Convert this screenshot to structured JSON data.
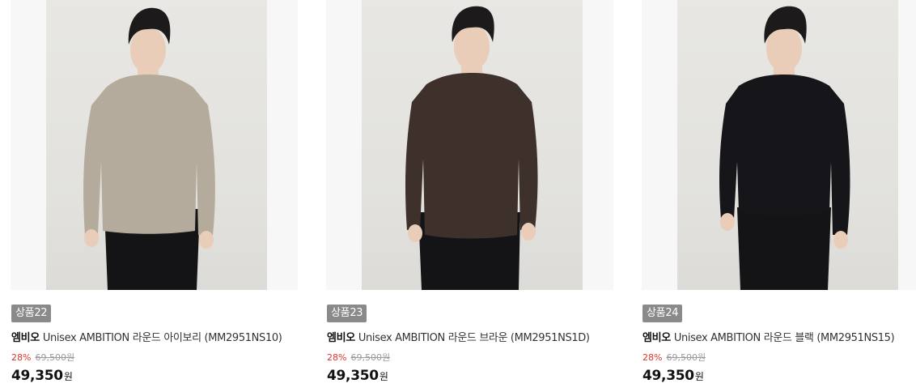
{
  "products": [
    {
      "badge": "상품22",
      "brand": "엠비오",
      "name": "Unisex AMBITION 라운드 아이보리 (MM2951NS10)",
      "discount": "28%",
      "original_price": "69,500원",
      "sale_price": "49,350",
      "currency": "원",
      "sweater_color": "#b5ab9c"
    },
    {
      "badge": "상품23",
      "brand": "엠비오",
      "name": "Unisex AMBITION 라운드 브라운 (MM2951NS1D)",
      "discount": "28%",
      "original_price": "69,500원",
      "sale_price": "49,350",
      "currency": "원",
      "sweater_color": "#3e302b"
    },
    {
      "badge": "상품24",
      "brand": "엠비오",
      "name": "Unisex AMBITION 라운드 블랙 (MM2951NS15)",
      "discount": "28%",
      "original_price": "69,500원",
      "sale_price": "49,350",
      "currency": "원",
      "sweater_color": "#16151a"
    }
  ],
  "colors": {
    "discount": "#e0332b",
    "badge_bg": "#8a8a8a",
    "pants": "#141416",
    "hair": "#1c1a1a",
    "skin": "#e9cdb9"
  }
}
